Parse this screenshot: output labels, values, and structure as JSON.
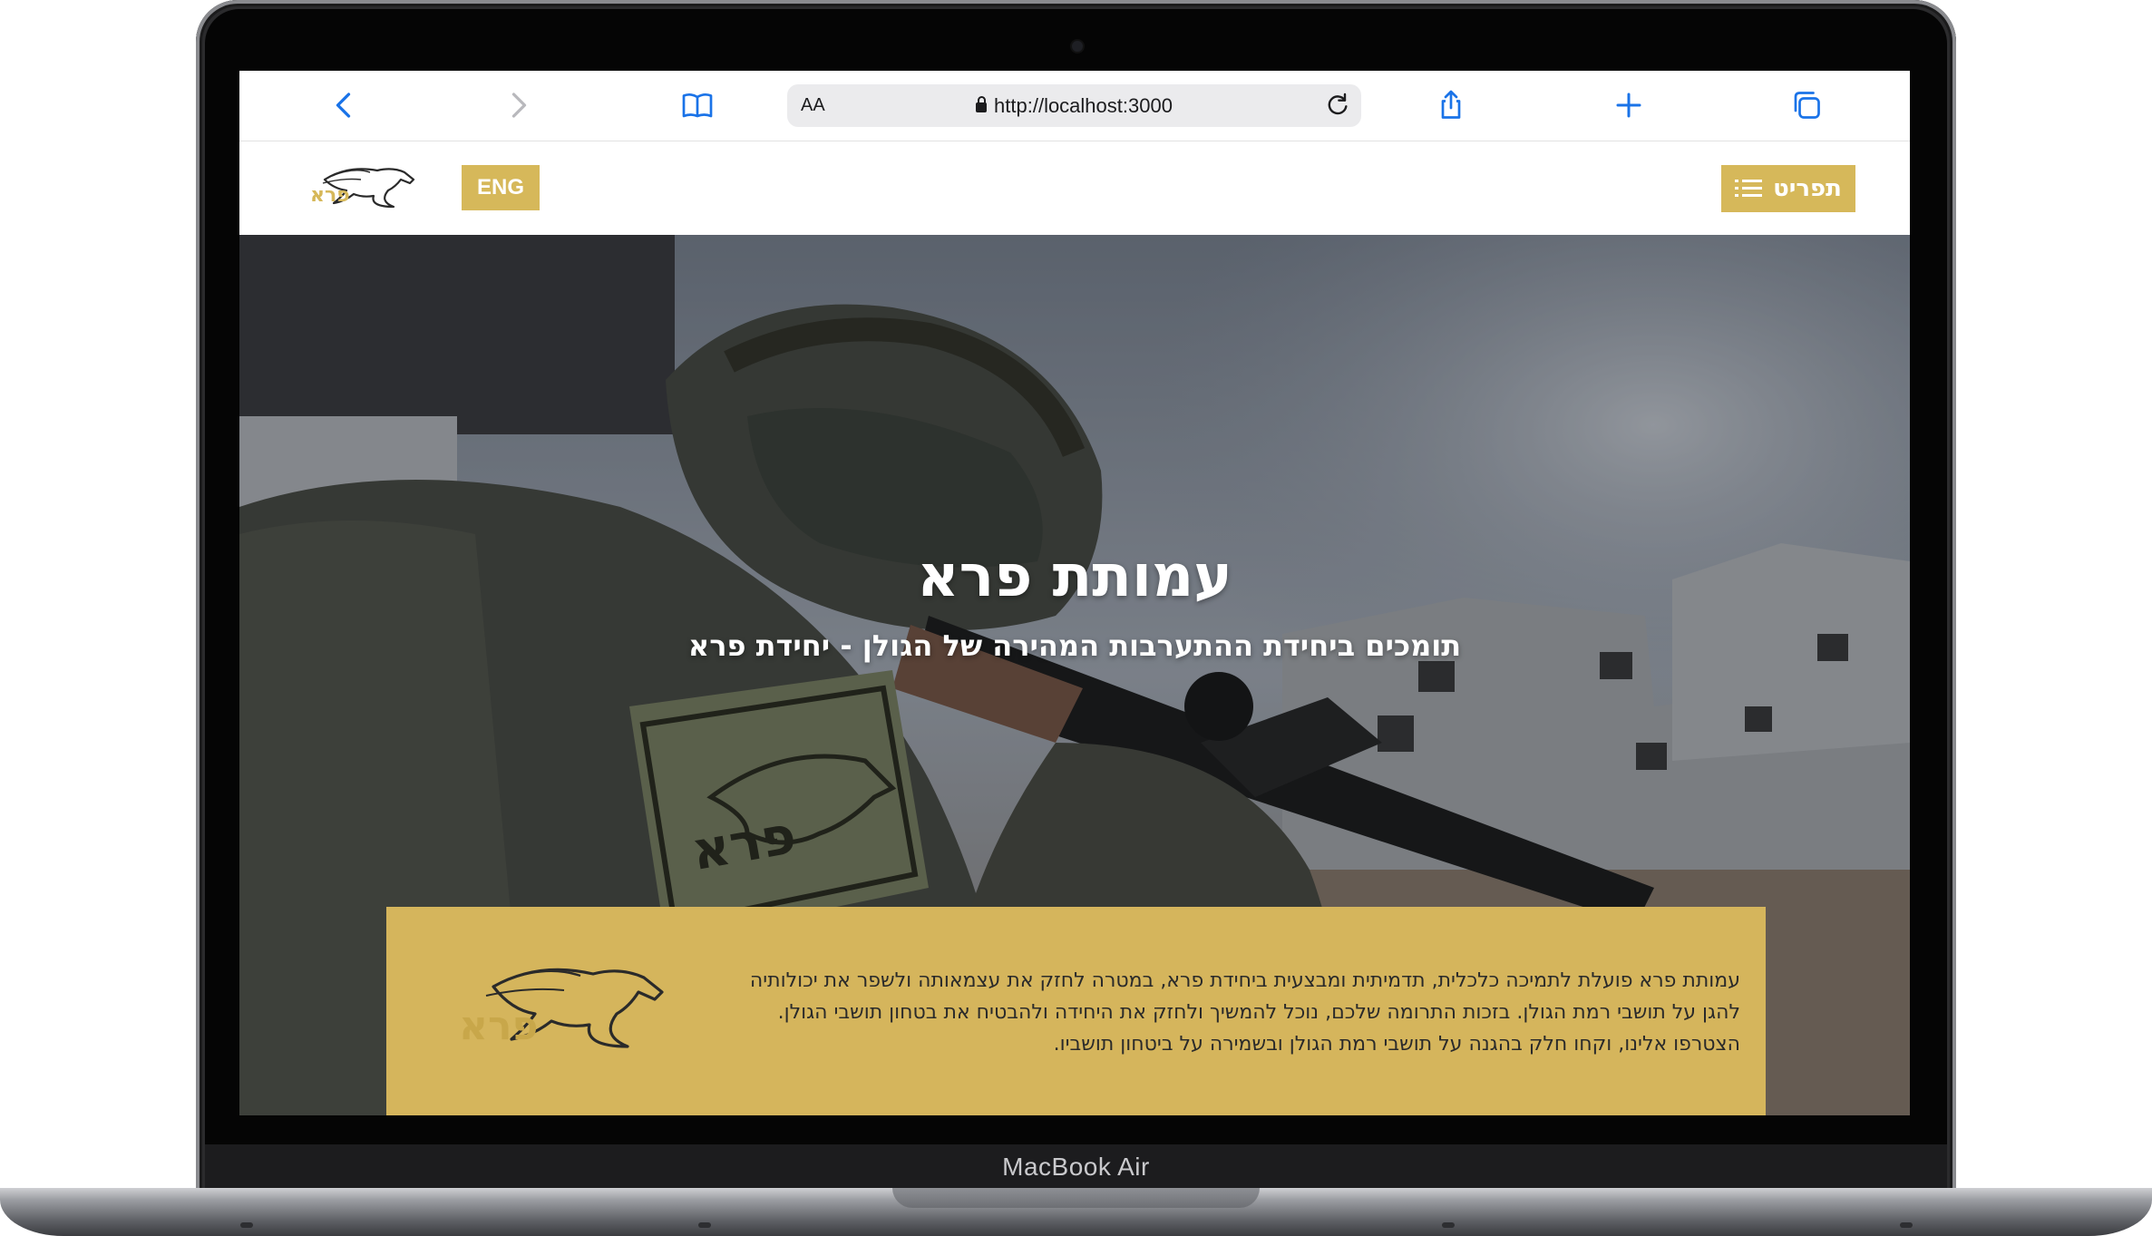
{
  "device": {
    "label": "MacBook Air"
  },
  "browser": {
    "url": "http://localhost:3000",
    "text_size_label": "AA",
    "icons": [
      "back-chevron-icon",
      "forward-chevron-icon",
      "bookmarks-book-icon",
      "lock-icon",
      "reload-icon",
      "share-icon",
      "new-tab-plus-icon",
      "tabs-overview-icon"
    ]
  },
  "header": {
    "language_button": "ENG",
    "menu_button": "תפריט",
    "logo_text": "פרא"
  },
  "hero": {
    "title": "עמותת פרא",
    "subtitle": "תומכים ביחידת ההתערבות המהירה של הגולן - יחידת פרא"
  },
  "info": {
    "lines": [
      "עמותת פרא פועלת לתמיכה כלכלית, תדמיתית ומבצעית ביחידת פרא, במטרה לחזק את עצמאותה ולשפר את יכולותיה",
      "להגן על תושבי רמת הגולן. בזכות התרומה שלכם, נוכל להמשיך ולחזק את היחידה ולהבטיח את בטחון תושבי הגולן.",
      "הצטרפו אלינו, וקחו חלק בהגנה על תושבי רמת הגולן ובשמירה על ביטחון תושביו."
    ],
    "logo_text": "פרא"
  },
  "colors": {
    "brand_gold": "#d6b85a",
    "accessibility_blue": "#3a58c4",
    "browser_accent": "#1a73e8"
  },
  "accessibility": {
    "icon": "accessibility-person-icon"
  }
}
